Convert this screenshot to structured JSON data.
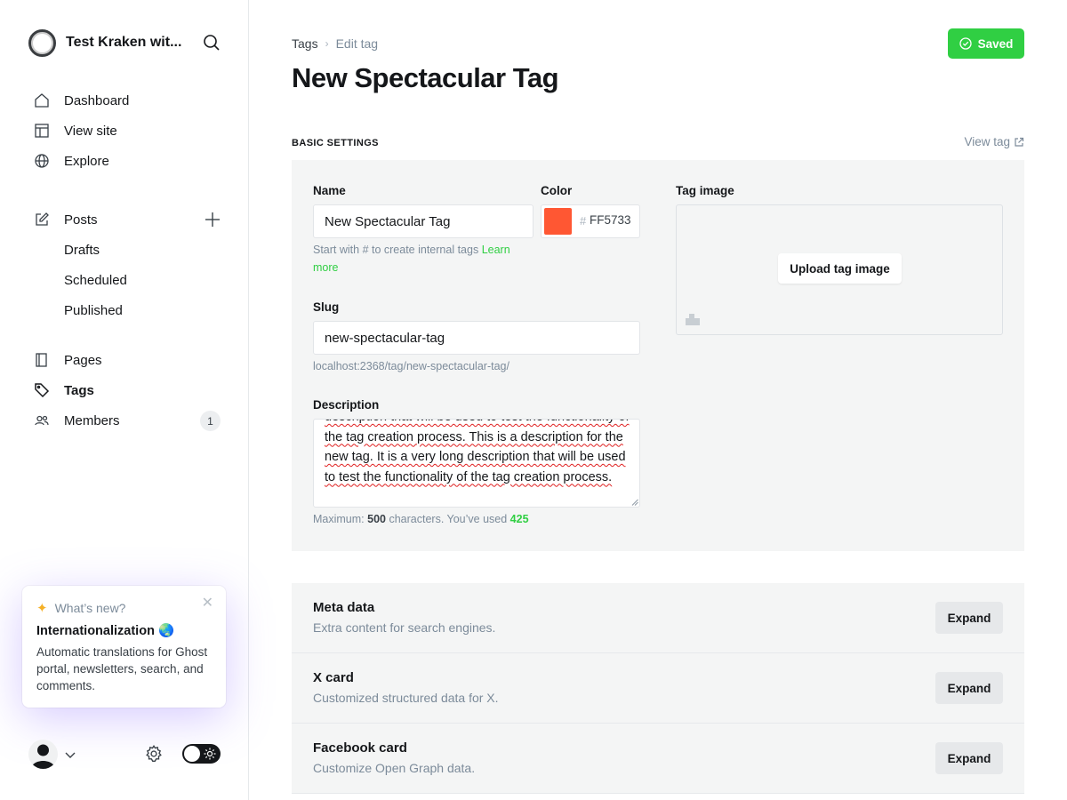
{
  "sidebar": {
    "site_title": "Test Kraken wit...",
    "nav": [
      {
        "label": "Dashboard",
        "icon": "house-icon"
      },
      {
        "label": "View site",
        "icon": "layout-icon"
      },
      {
        "label": "Explore",
        "icon": "globe-icon"
      }
    ],
    "posts": {
      "label": "Posts",
      "drafts": "Drafts",
      "scheduled": "Scheduled",
      "published": "Published"
    },
    "pages": "Pages",
    "tags": "Tags",
    "members": {
      "label": "Members",
      "count": "1"
    },
    "whats_new": {
      "heading": "What’s new?",
      "title": "Internationalization 🌏",
      "body": "Automatic translations for Ghost portal, newsletters, search, and comments."
    }
  },
  "header": {
    "breadcrumb_root": "Tags",
    "breadcrumb_current": "Edit tag",
    "title": "New Spectacular Tag",
    "saved_label": "Saved"
  },
  "basic": {
    "section_label": "BASIC SETTINGS",
    "view_tag": "View tag",
    "name_label": "Name",
    "name_value": "New Spectacular Tag",
    "name_hint": "Start with # to create internal tags",
    "learn_more": "Learn more",
    "color_label": "Color",
    "color_hash": "#",
    "color_value": "FF5733",
    "color_hex": "#ff5733",
    "tag_image_label": "Tag image",
    "upload_label": "Upload tag image",
    "slug_label": "Slug",
    "slug_value": "new-spectacular-tag",
    "slug_url": "localhost:2368/tag/new-spectacular-tag/",
    "description_label": "Description",
    "description_value": "description that will be used to test the functionality of the tag creation process. This is a description for the new tag. It is a very long description that will be used to test the functionality of the tag creation process.",
    "max_prefix": "Maximum: ",
    "max_count": "500",
    "max_mid": " characters. You’ve used ",
    "used_count": "425"
  },
  "sections": [
    {
      "title": "Meta data",
      "subtitle": "Extra content for search engines.",
      "button": "Expand"
    },
    {
      "title": "X card",
      "subtitle": "Customized structured data for X.",
      "button": "Expand"
    },
    {
      "title": "Facebook card",
      "subtitle": "Customize Open Graph data.",
      "button": "Expand"
    }
  ],
  "colors": {
    "accent": "#30cf43",
    "tag_color": "#ff5733"
  }
}
